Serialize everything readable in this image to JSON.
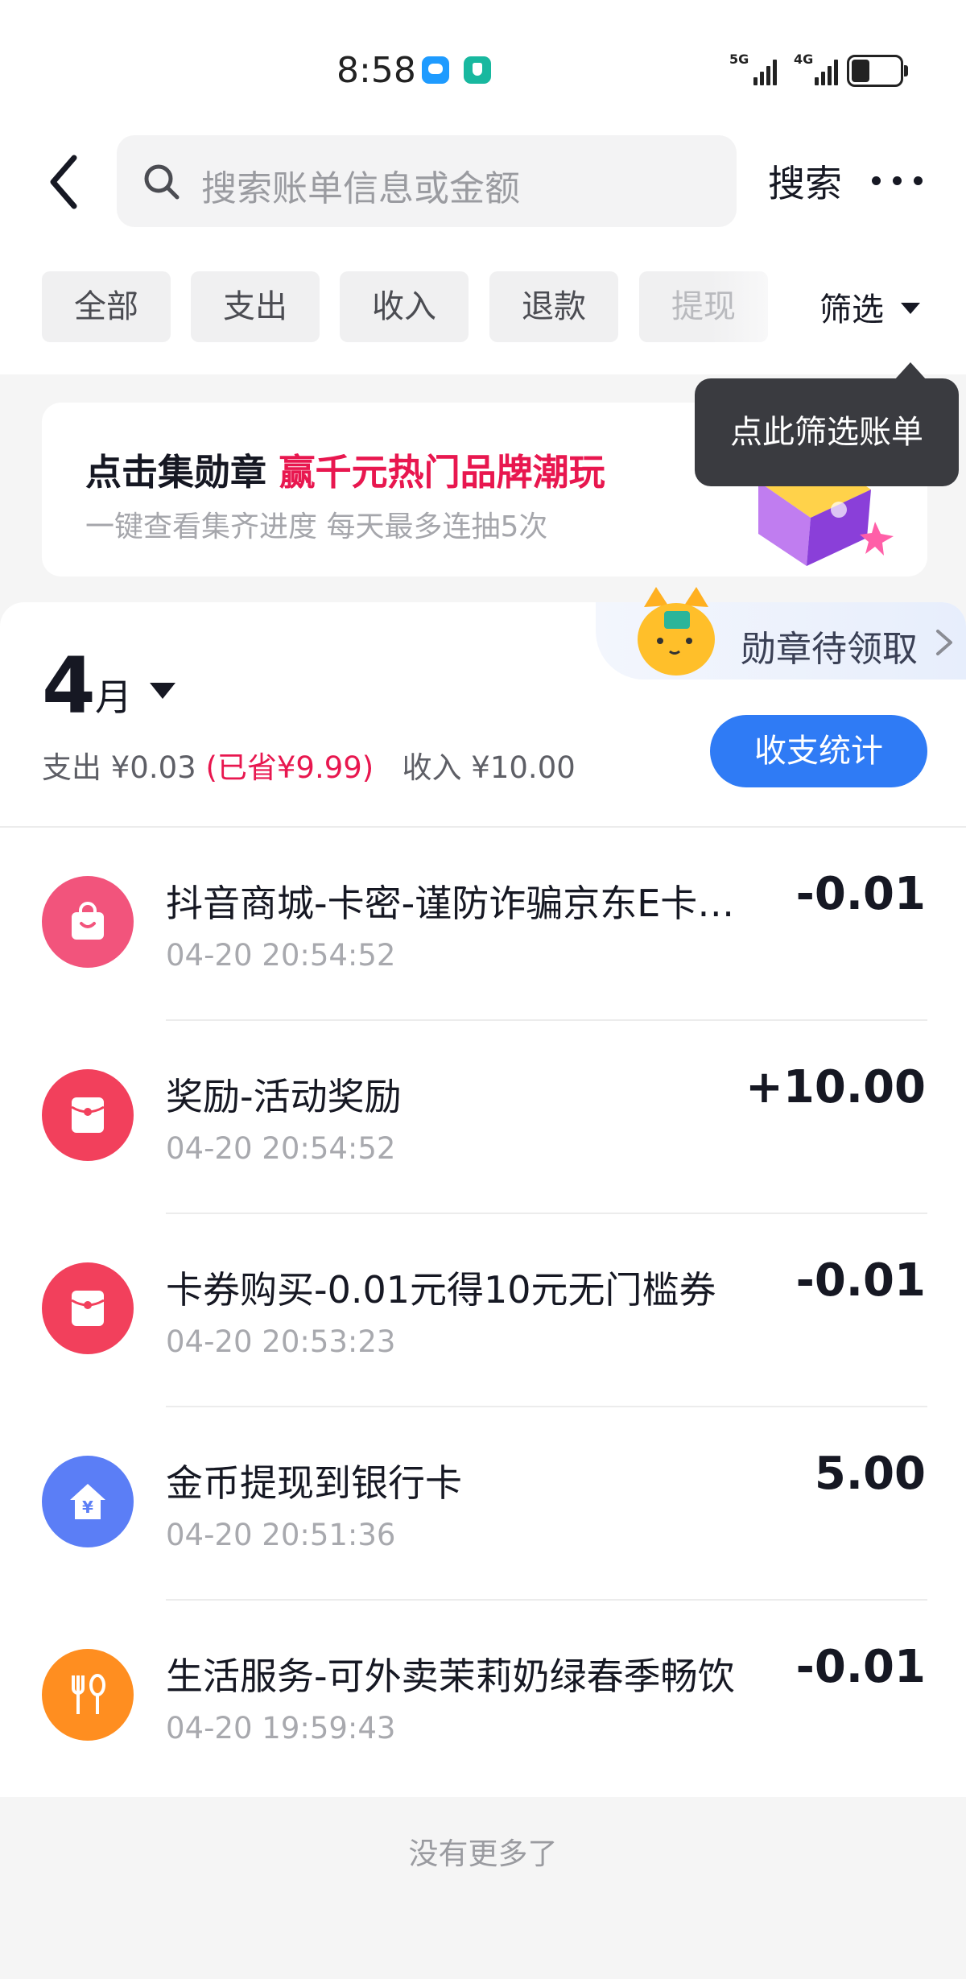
{
  "status_bar": {
    "time": "8:58",
    "net1": "5G",
    "net2": "4G"
  },
  "search": {
    "placeholder": "搜索账单信息或金额",
    "button_label": "搜索"
  },
  "filters": {
    "chips": [
      "全部",
      "支出",
      "收入",
      "退款",
      "提现"
    ],
    "filter_label": "筛选"
  },
  "tooltip": "点此筛选账单",
  "banner": {
    "title_prefix": "点击集勋章 ",
    "title_highlight": "赢千元热门品牌潮玩",
    "subtitle": "一键查看集齐进度 每天最多连抽5次"
  },
  "medal_tab": {
    "label": "勋章待领取"
  },
  "month": {
    "number": "4",
    "unit": "月",
    "expense_label": "支出 ¥0.03",
    "saved_label": "(已省¥9.99)",
    "income_label": "收入 ¥10.00",
    "stats_button": "收支统计"
  },
  "transactions": [
    {
      "title": "抖音商城-卡密-谨防诈骗京东E卡…",
      "time": "04-20 20:54:52",
      "amount": "-0.01",
      "icon": "shopping-bag-icon",
      "color": "#f2547c"
    },
    {
      "title": "奖励-活动奖励",
      "time": "04-20 20:54:52",
      "amount": "+10.00",
      "icon": "red-packet-icon",
      "color": "#f2405c"
    },
    {
      "title": "卡券购买-0.01元得10元无门槛券",
      "time": "04-20 20:53:23",
      "amount": "-0.01",
      "icon": "red-packet-icon",
      "color": "#f2405c"
    },
    {
      "title": "金币提现到银行卡",
      "time": "04-20 20:51:36",
      "amount": "5.00",
      "icon": "yuan-house-icon",
      "color": "#5b7ef6"
    },
    {
      "title": "生活服务-可外卖茉莉奶绿春季畅饮",
      "time": "04-20 19:59:43",
      "amount": "-0.01",
      "icon": "fork-spoon-icon",
      "color": "#ff8e20"
    }
  ],
  "footer": {
    "no_more": "没有更多了"
  }
}
